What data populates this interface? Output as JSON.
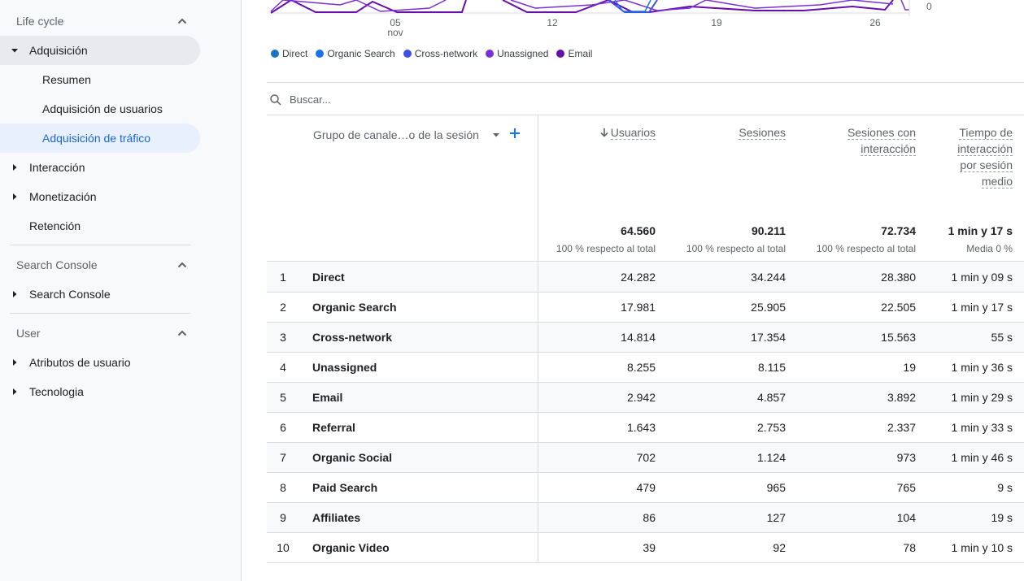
{
  "sidebar": {
    "life_cycle": "Life cycle",
    "adquisicion": "Adquisición",
    "resumen": "Resumen",
    "adq_usuarios": "Adquisición de usuarios",
    "adq_trafico": "Adquisición de tráfico",
    "interaccion": "Interacción",
    "monetizacion": "Monetización",
    "retencion": "Retención",
    "search_console_section": "Search Console",
    "search_console_item": "Search Console",
    "user_section": "User",
    "atributos": "Atributos de usuario",
    "tecnologia": "Tecnologia"
  },
  "chart": {
    "x_ticks": [
      {
        "day": "05",
        "month": "nov"
      },
      {
        "day": "12",
        "month": ""
      },
      {
        "day": "19",
        "month": ""
      },
      {
        "day": "26",
        "month": ""
      }
    ],
    "y_zero": "0",
    "legend": [
      {
        "label": "Direct",
        "color": "#1a73e8"
      },
      {
        "label": "Organic Search",
        "color": "#1a73e8"
      },
      {
        "label": "Cross-network",
        "color": "#3f51e5"
      },
      {
        "label": "Unassigned",
        "color": "#7b2fd6"
      },
      {
        "label": "Email",
        "color": "#6a0dad"
      }
    ]
  },
  "search": {
    "placeholder": "Buscar..."
  },
  "table": {
    "dimension_header": "Grupo de canale…o de la sesión",
    "metrics": [
      {
        "label": "Usuarios",
        "total": "64.560",
        "pct": "100 % respecto al total"
      },
      {
        "label": "Sesiones",
        "total": "90.211",
        "pct": "100 % respecto al total"
      },
      {
        "label": "Sesiones con interacción",
        "total": "72.734",
        "pct": "100 % respecto al total"
      },
      {
        "label": "Tiempo de interacción por sesión medio",
        "total": "1 min y 17 s",
        "pct": "Media 0 %"
      }
    ],
    "rows": [
      {
        "idx": "1",
        "name": "Direct",
        "users": "24.282",
        "sessions": "34.244",
        "engaged": "28.380",
        "time": "1 min y 09 s"
      },
      {
        "idx": "2",
        "name": "Organic Search",
        "users": "17.981",
        "sessions": "25.905",
        "engaged": "22.505",
        "time": "1 min y 17 s"
      },
      {
        "idx": "3",
        "name": "Cross-network",
        "users": "14.814",
        "sessions": "17.354",
        "engaged": "15.563",
        "time": "55 s"
      },
      {
        "idx": "4",
        "name": "Unassigned",
        "users": "8.255",
        "sessions": "8.115",
        "engaged": "19",
        "time": "1 min y 36 s"
      },
      {
        "idx": "5",
        "name": "Email",
        "users": "2.942",
        "sessions": "4.857",
        "engaged": "3.892",
        "time": "1 min y 29 s"
      },
      {
        "idx": "6",
        "name": "Referral",
        "users": "1.643",
        "sessions": "2.753",
        "engaged": "2.337",
        "time": "1 min y 33 s"
      },
      {
        "idx": "7",
        "name": "Organic Social",
        "users": "702",
        "sessions": "1.124",
        "engaged": "973",
        "time": "1 min y 46 s"
      },
      {
        "idx": "8",
        "name": "Paid Search",
        "users": "479",
        "sessions": "965",
        "engaged": "765",
        "time": "9 s"
      },
      {
        "idx": "9",
        "name": "Affiliates",
        "users": "86",
        "sessions": "127",
        "engaged": "104",
        "time": "19 s"
      },
      {
        "idx": "10",
        "name": "Organic Video",
        "users": "39",
        "sessions": "92",
        "engaged": "78",
        "time": "1 min y 10 s"
      }
    ]
  }
}
